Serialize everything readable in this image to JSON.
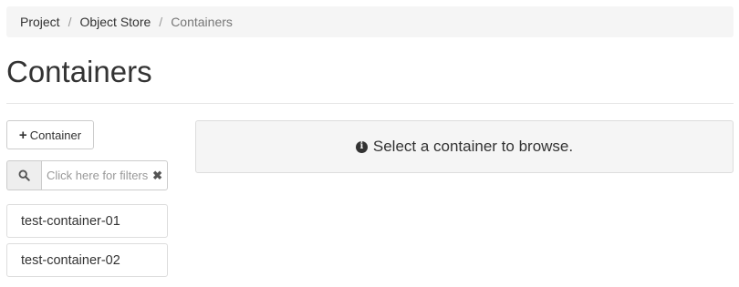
{
  "breadcrumb": {
    "items": [
      "Project",
      "Object Store",
      "Containers"
    ],
    "separator": "/"
  },
  "page": {
    "title": "Containers"
  },
  "toolbar": {
    "add_container_label": "Container",
    "add_icon": "plus-icon"
  },
  "filter": {
    "placeholder": "Click here for filters",
    "search_icon": "search-icon",
    "clear_icon": "clear-icon"
  },
  "containers": [
    {
      "name": "test-container-01"
    },
    {
      "name": "test-container-02"
    }
  ],
  "info_panel": {
    "icon": "info-icon",
    "message": "Select a container to browse."
  }
}
